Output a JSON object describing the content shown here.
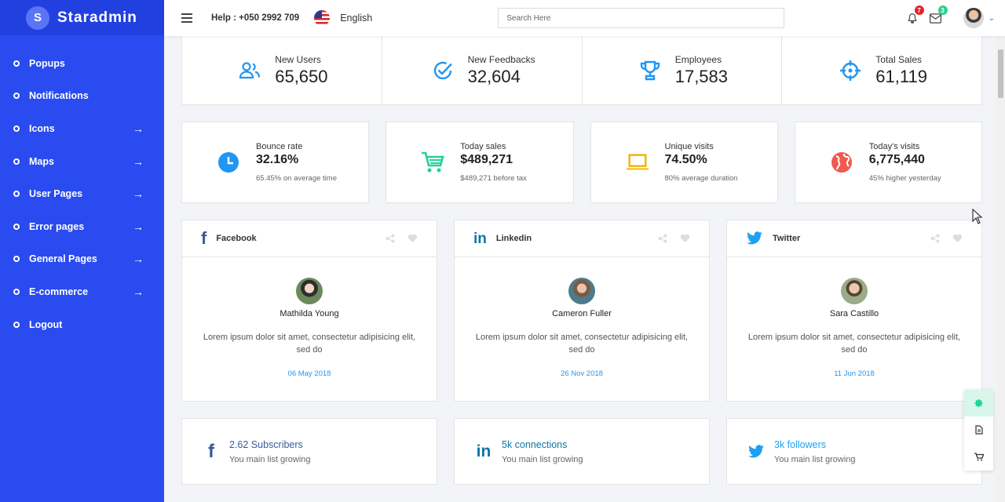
{
  "brand": {
    "logo_letter": "S",
    "name": "Staradmin"
  },
  "sidebar": {
    "items": [
      {
        "label": "Popups",
        "has_arrow": false
      },
      {
        "label": "Notifications",
        "has_arrow": false
      },
      {
        "label": "Icons",
        "has_arrow": true
      },
      {
        "label": "Maps",
        "has_arrow": true
      },
      {
        "label": "User Pages",
        "has_arrow": true
      },
      {
        "label": "Error pages",
        "has_arrow": true
      },
      {
        "label": "General Pages",
        "has_arrow": true
      },
      {
        "label": "E-commerce",
        "has_arrow": true
      },
      {
        "label": "Logout",
        "has_arrow": false
      }
    ]
  },
  "topbar": {
    "help": "Help : +050 2992 709",
    "language": "English",
    "search_placeholder": "Search Here",
    "notifications_count": "7",
    "messages_count": "3"
  },
  "stats": [
    {
      "label": "New Users",
      "value": "65,650",
      "icon": "users-icon"
    },
    {
      "label": "New Feedbacks",
      "value": "32,604",
      "icon": "check-circle-icon"
    },
    {
      "label": "Employees",
      "value": "17,583",
      "icon": "trophy-icon"
    },
    {
      "label": "Total Sales",
      "value": "61,119",
      "icon": "crosshair-icon"
    }
  ],
  "cards": [
    {
      "label": "Bounce rate",
      "value": "32.16%",
      "sub": "65.45% on average time",
      "icon": "clock-icon"
    },
    {
      "label": "Today sales",
      "value": "$489,271",
      "sub": "$489,271 before tax",
      "icon": "cart-icon"
    },
    {
      "label": "Unique visits",
      "value": "74.50%",
      "sub": "80% average duration",
      "icon": "laptop-icon"
    },
    {
      "label": "Today's visits",
      "value": "6,775,440",
      "sub": "45% higher yesterday",
      "icon": "globe-icon"
    }
  ],
  "social": [
    {
      "network": "Facebook",
      "person": "Mathilda Young",
      "text": "Lorem ipsum dolor sit amet, consectetur adipisicing elit, sed do",
      "date": "06 May 2018"
    },
    {
      "network": "Linkedin",
      "person": "Cameron Fuller",
      "text": "Lorem ipsum dolor sit amet, consectetur adipisicing elit, sed do",
      "date": "26 Nov 2018"
    },
    {
      "network": "Twitter",
      "person": "Sara Castillo",
      "text": "Lorem ipsum dolor sit amet, consectetur adipisicing elit, sed do",
      "date": "11 Jun 2018"
    }
  ],
  "followers": [
    {
      "count": "2.62 Subscribers",
      "sub": "You main list growing"
    },
    {
      "count": "5k connections",
      "sub": "You main list growing"
    },
    {
      "count": "3k followers",
      "sub": "You main list growing"
    }
  ],
  "colors": {
    "sidebar": "#2a4bf0",
    "primary_blue": "#2196f3",
    "facebook": "#3b5998",
    "linkedin": "#0e76a8",
    "twitter": "#1da1f2",
    "green": "#1fd29a",
    "yellow": "#f4b400",
    "red": "#f05a4f"
  }
}
